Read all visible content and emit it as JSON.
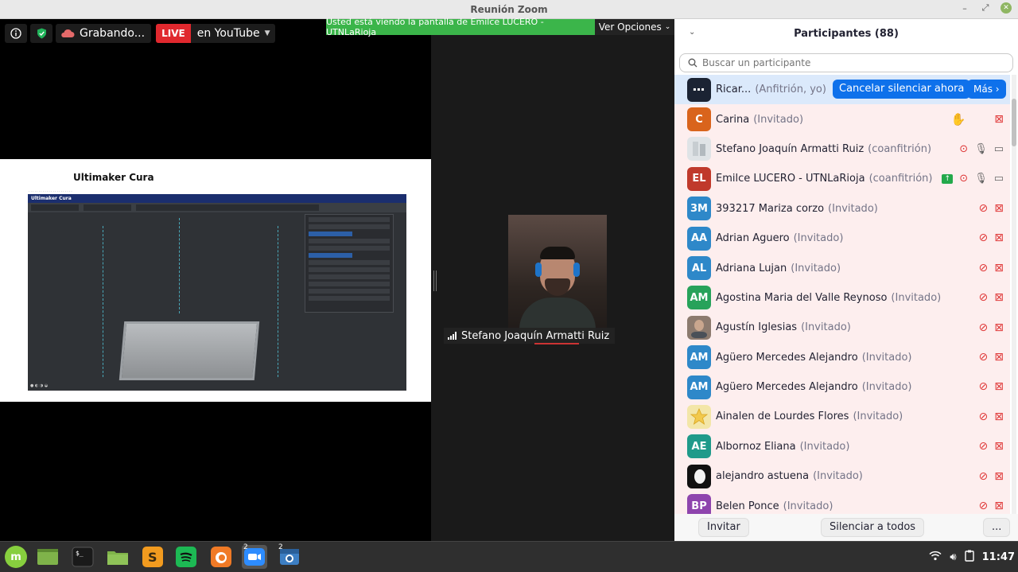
{
  "window": {
    "title": "Reunión Zoom"
  },
  "meeting": {
    "recording_label": "Grabando...",
    "live_badge": "LIVE",
    "live_target": "en YouTube",
    "viewing_banner": "Usted está viendo la pantalla de Emilce LUCERO - UTNLaRioja",
    "view_options": "Ver Opciones",
    "share_title": "Ultimaker Cura",
    "cura_logo": "Ultimaker Cura",
    "video_name": "Stefano Joaquín Armatti Ruiz"
  },
  "participants": {
    "title": "Participantes (88)",
    "search_placeholder": "Buscar un participante",
    "me": {
      "name": "Ricar...",
      "role": "(Anfitrión, yo)",
      "cancel_btn": "Cancelar silenciar ahora",
      "more_btn": "Más"
    },
    "list": [
      {
        "initials": "C",
        "color": "#d9641c",
        "name": "Carina",
        "role": "(Invitado)"
      },
      {
        "initials": "",
        "color": "#dfe3e6",
        "name": "Stefano Joaquín Armatti Ruiz",
        "role": "(coanfitrión)"
      },
      {
        "initials": "EL",
        "color": "#c0392b",
        "name": "Emilce LUCERO - UTNLaRioja",
        "role": "(coanfitrión)"
      },
      {
        "initials": "3M",
        "color": "#2e88c9",
        "name": "393217 Mariza corzo",
        "role": "(Invitado)"
      },
      {
        "initials": "AA",
        "color": "#2e88c9",
        "name": "Adrian Aguero",
        "role": "(Invitado)"
      },
      {
        "initials": "AL",
        "color": "#2e88c9",
        "name": "Adriana Lujan",
        "role": "(Invitado)"
      },
      {
        "initials": "AM",
        "color": "#27a25a",
        "name": "Agostina Maria del Valle Reynoso",
        "role": "(Invitado)"
      },
      {
        "initials": "",
        "color": "#8c7a6e",
        "name": "Agustín Iglesias",
        "role": "(Invitado)"
      },
      {
        "initials": "AM",
        "color": "#2e88c9",
        "name": "Agüero Mercedes Alejandro",
        "role": "(Invitado)"
      },
      {
        "initials": "AM",
        "color": "#2e88c9",
        "name": "Agüero Mercedes Alejandro",
        "role": "(Invitado)"
      },
      {
        "initials": "",
        "color": "#f3e6a8",
        "name": "Ainalen de Lourdes Flores",
        "role": "(Invitado)"
      },
      {
        "initials": "AE",
        "color": "#1f9a8a",
        "name": "Albornoz Eliana",
        "role": "(Invitado)"
      },
      {
        "initials": "",
        "color": "#111111",
        "name": "alejandro astuena",
        "role": "(Invitado)"
      },
      {
        "initials": "BP",
        "color": "#8e44ad",
        "name": "Belen Ponce",
        "role": "(Invitado)"
      }
    ],
    "footer": {
      "invite": "Invitar",
      "mute_all": "Silenciar a todos",
      "more": "..."
    }
  },
  "taskbar": {
    "zoom_badge": "2",
    "camera_badge": "2",
    "clock": "11:47"
  }
}
